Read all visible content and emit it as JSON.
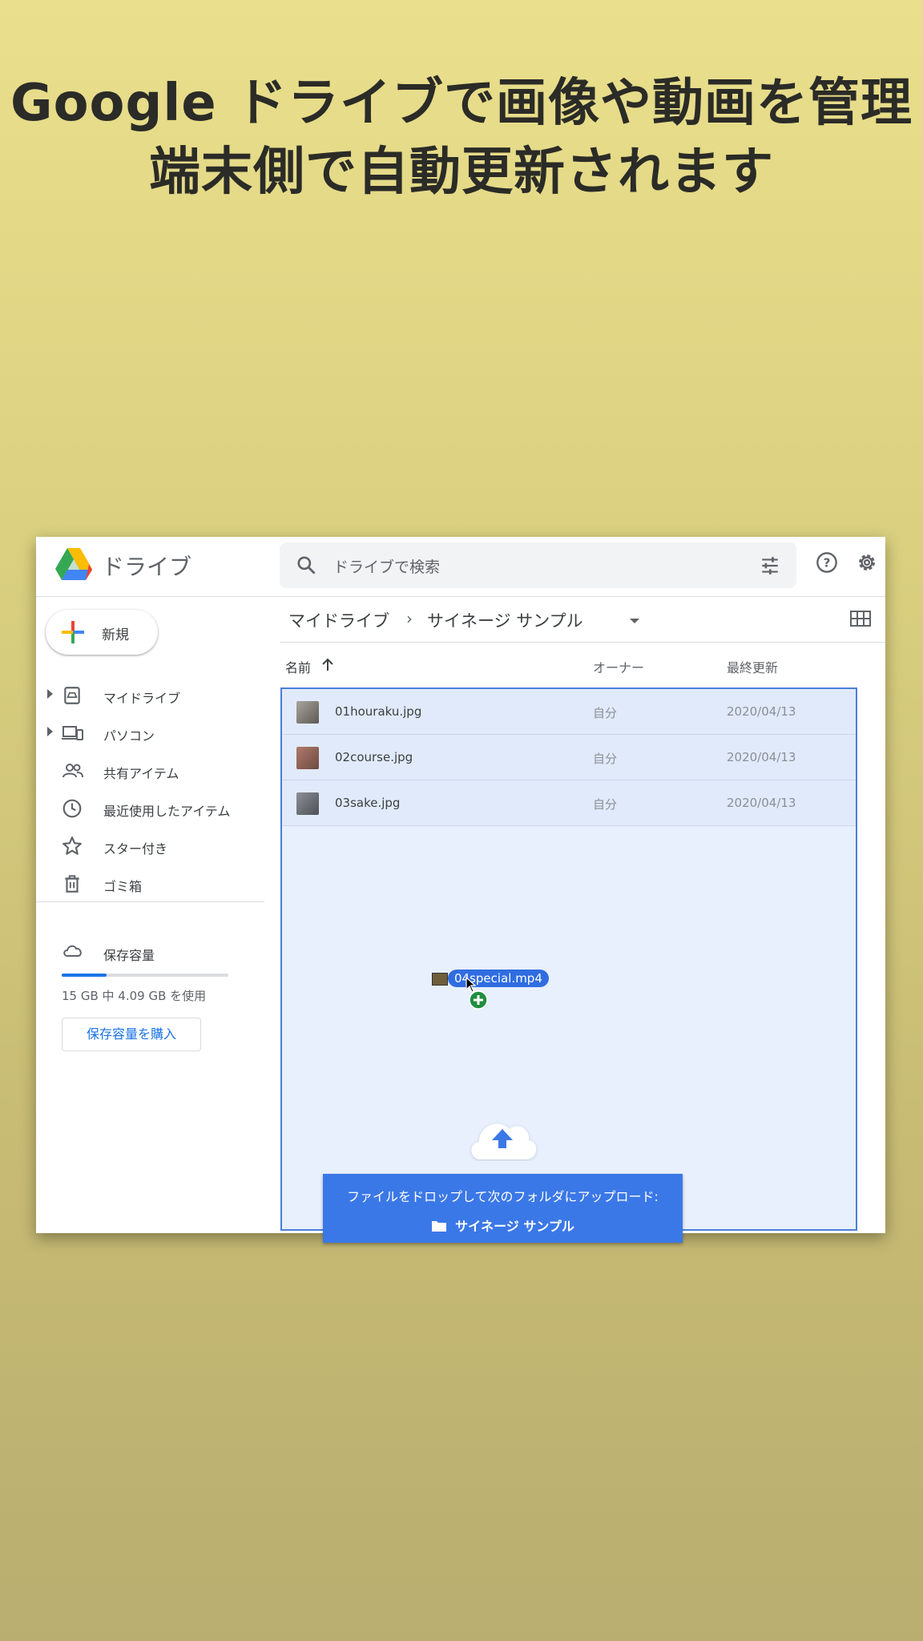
{
  "headline": {
    "line1": "Google ドライブで画像や動画を管理",
    "line2": "端末側で自動更新されます"
  },
  "app": {
    "title": "ドライブ",
    "logo_icon": "google-drive-logo",
    "search_placeholder": "ドライブで検索"
  },
  "sidebar": {
    "new_label": "新規",
    "items": [
      {
        "label": "マイドライブ",
        "icon": "my-drive-icon"
      },
      {
        "label": "パソコン",
        "icon": "computers-icon"
      },
      {
        "label": "共有アイテム",
        "icon": "shared-people-icon"
      },
      {
        "label": "最近使用したアイテム",
        "icon": "clock-icon"
      },
      {
        "label": "スター付き",
        "icon": "star-icon"
      },
      {
        "label": "ゴミ箱",
        "icon": "trash-icon"
      }
    ],
    "storage_label": "保存容量",
    "storage_text": "15 GB 中 4.09 GB を使用",
    "storage_used_fraction": 0.27,
    "buy_label": "保存容量を購入"
  },
  "breadcrumb": {
    "root": "マイドライブ",
    "current": "サイネージ サンプル"
  },
  "columns": {
    "name": "名前",
    "owner": "オーナー",
    "modified": "最終更新"
  },
  "files": [
    {
      "name": "01houraku.jpg",
      "owner": "自分",
      "modified": "2020/04/13"
    },
    {
      "name": "02course.jpg",
      "owner": "自分",
      "modified": "2020/04/13"
    },
    {
      "name": "03sake.jpg",
      "owner": "自分",
      "modified": "2020/04/13"
    }
  ],
  "drag": {
    "file_name": "04special.mp4"
  },
  "drop": {
    "message": "ファイルをドロップして次のフォルダにアップロード:",
    "folder": "サイネージ サンプル"
  },
  "colors": {
    "accent": "#1a73e8",
    "drop_banner": "#3b78e7",
    "drop_zone_bg": "#e8f0fe"
  }
}
